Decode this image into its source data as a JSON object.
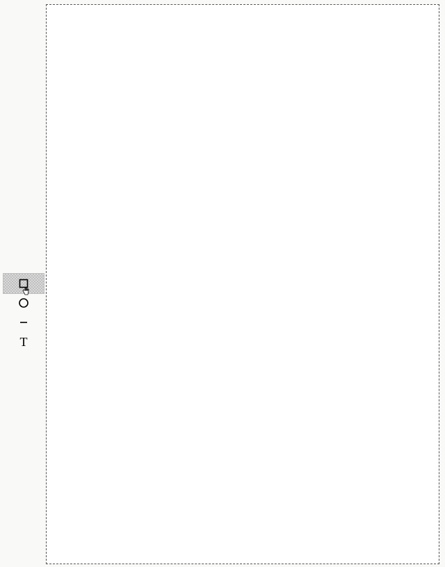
{
  "toolbox": {
    "tools": [
      {
        "id": "rectangle",
        "name": "rectangle-tool",
        "glyph": "rect",
        "selected": true
      },
      {
        "id": "circle",
        "name": "circle-tool",
        "glyph": "circle",
        "selected": false
      },
      {
        "id": "line",
        "name": "line-tool",
        "glyph": "line",
        "selected": false
      },
      {
        "id": "text",
        "name": "text-tool",
        "glyph": "T",
        "selected": false
      }
    ]
  },
  "canvas": {
    "empty": true
  },
  "colors": {
    "page_bg": "#f9f9f7",
    "canvas_bg": "#ffffff",
    "border": "#555555",
    "selected_a": "#bfbfbf",
    "selected_b": "#d9d9d9"
  }
}
